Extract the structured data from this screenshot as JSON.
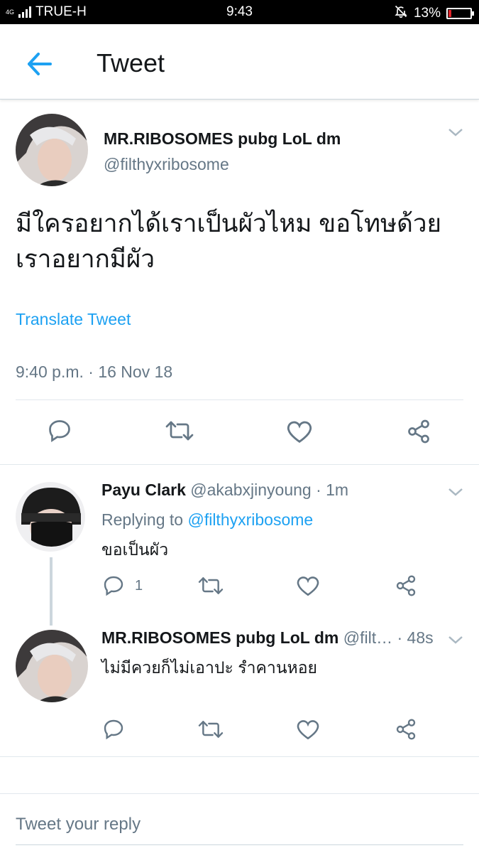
{
  "status_bar": {
    "network": "TRUE-H",
    "network_badge": "4G",
    "time": "9:43",
    "battery": "13%",
    "battery_level": 0.13
  },
  "header": {
    "title": "Tweet",
    "back_icon": "back-arrow-icon"
  },
  "tweet": {
    "author_name": "MR.RIBOSOMES pubg LoL dm",
    "author_handle": "@filthyxribosome",
    "text_line1": "มีใครอยากได้เราเป็นผัวไหม ขอโทษด้วย",
    "text_line2": "เราอยากมีผัว",
    "translate_label": "Translate Tweet",
    "timestamp": "9:40 p.m. · 16 Nov 18",
    "actions": [
      "reply-icon",
      "retweet-icon",
      "like-icon",
      "share-icon"
    ]
  },
  "replies": [
    {
      "name": "Payu Clark",
      "handle": "@akabxjinyoung",
      "time": "· 1m",
      "replying_prefix": "Replying to",
      "replying_to": "@filthyxribosome",
      "text": "ขอเป็นผัว",
      "reply_count": "1"
    },
    {
      "name": "MR.RIBOSOMES pubg LoL dm",
      "handle": "@filt…",
      "time": "· 48s",
      "text": "ไม่มีควยก็ไม่เอาปะ รำคานหอย"
    }
  ],
  "composer": {
    "placeholder": "Tweet your reply"
  },
  "colors": {
    "accent": "#1da1f2",
    "text": "#14171a",
    "muted": "#657786",
    "icon": "#657786",
    "battery_low": "#e0242a"
  }
}
